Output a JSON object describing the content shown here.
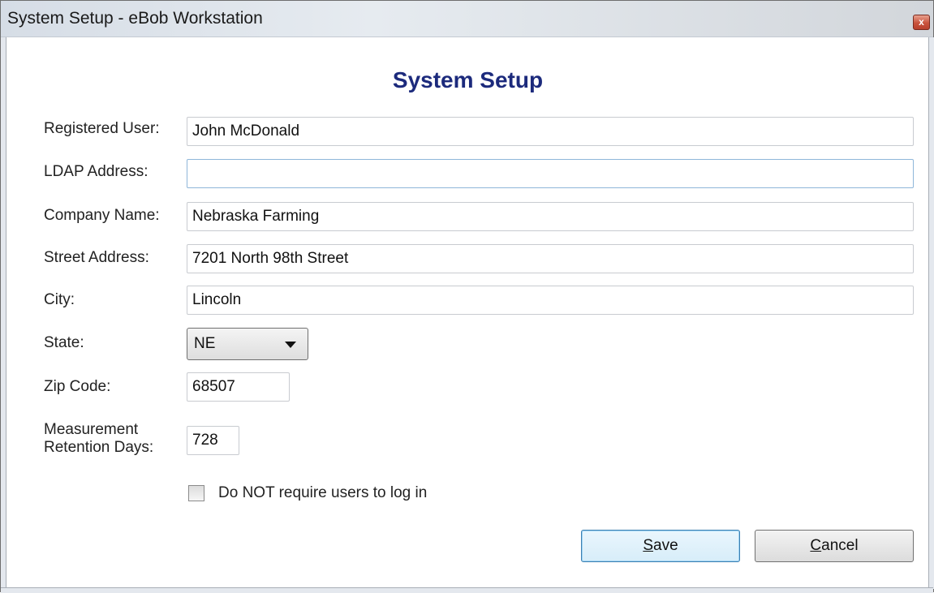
{
  "window": {
    "title": "System Setup - eBob Workstation",
    "close_glyph": "x"
  },
  "form": {
    "heading": "System Setup",
    "fields": {
      "registered_user": {
        "label": "Registered User:",
        "value": "John McDonald"
      },
      "ldap_address": {
        "label": "LDAP Address:",
        "value": ""
      },
      "company_name": {
        "label": "Company Name:",
        "value": "Nebraska Farming"
      },
      "street_address": {
        "label": "Street Address:",
        "value": "7201 North 98th Street"
      },
      "city": {
        "label": "City:",
        "value": "Lincoln"
      },
      "state": {
        "label": "State:",
        "value": "NE"
      },
      "zip_code": {
        "label": "Zip Code:",
        "value": "68507"
      },
      "retention_days": {
        "label_line1": "Measurement",
        "label_line2": "Retention Days:",
        "value": "728"
      }
    },
    "no_login_checkbox": {
      "label": "Do NOT require users to log in",
      "checked": false
    },
    "buttons": {
      "save": {
        "mnemonic": "S",
        "rest": "ave"
      },
      "cancel": {
        "mnemonic": "C",
        "rest": "ancel"
      }
    }
  },
  "colors": {
    "heading": "#1c2a7c",
    "default_button_border": "#3c7fb1"
  }
}
